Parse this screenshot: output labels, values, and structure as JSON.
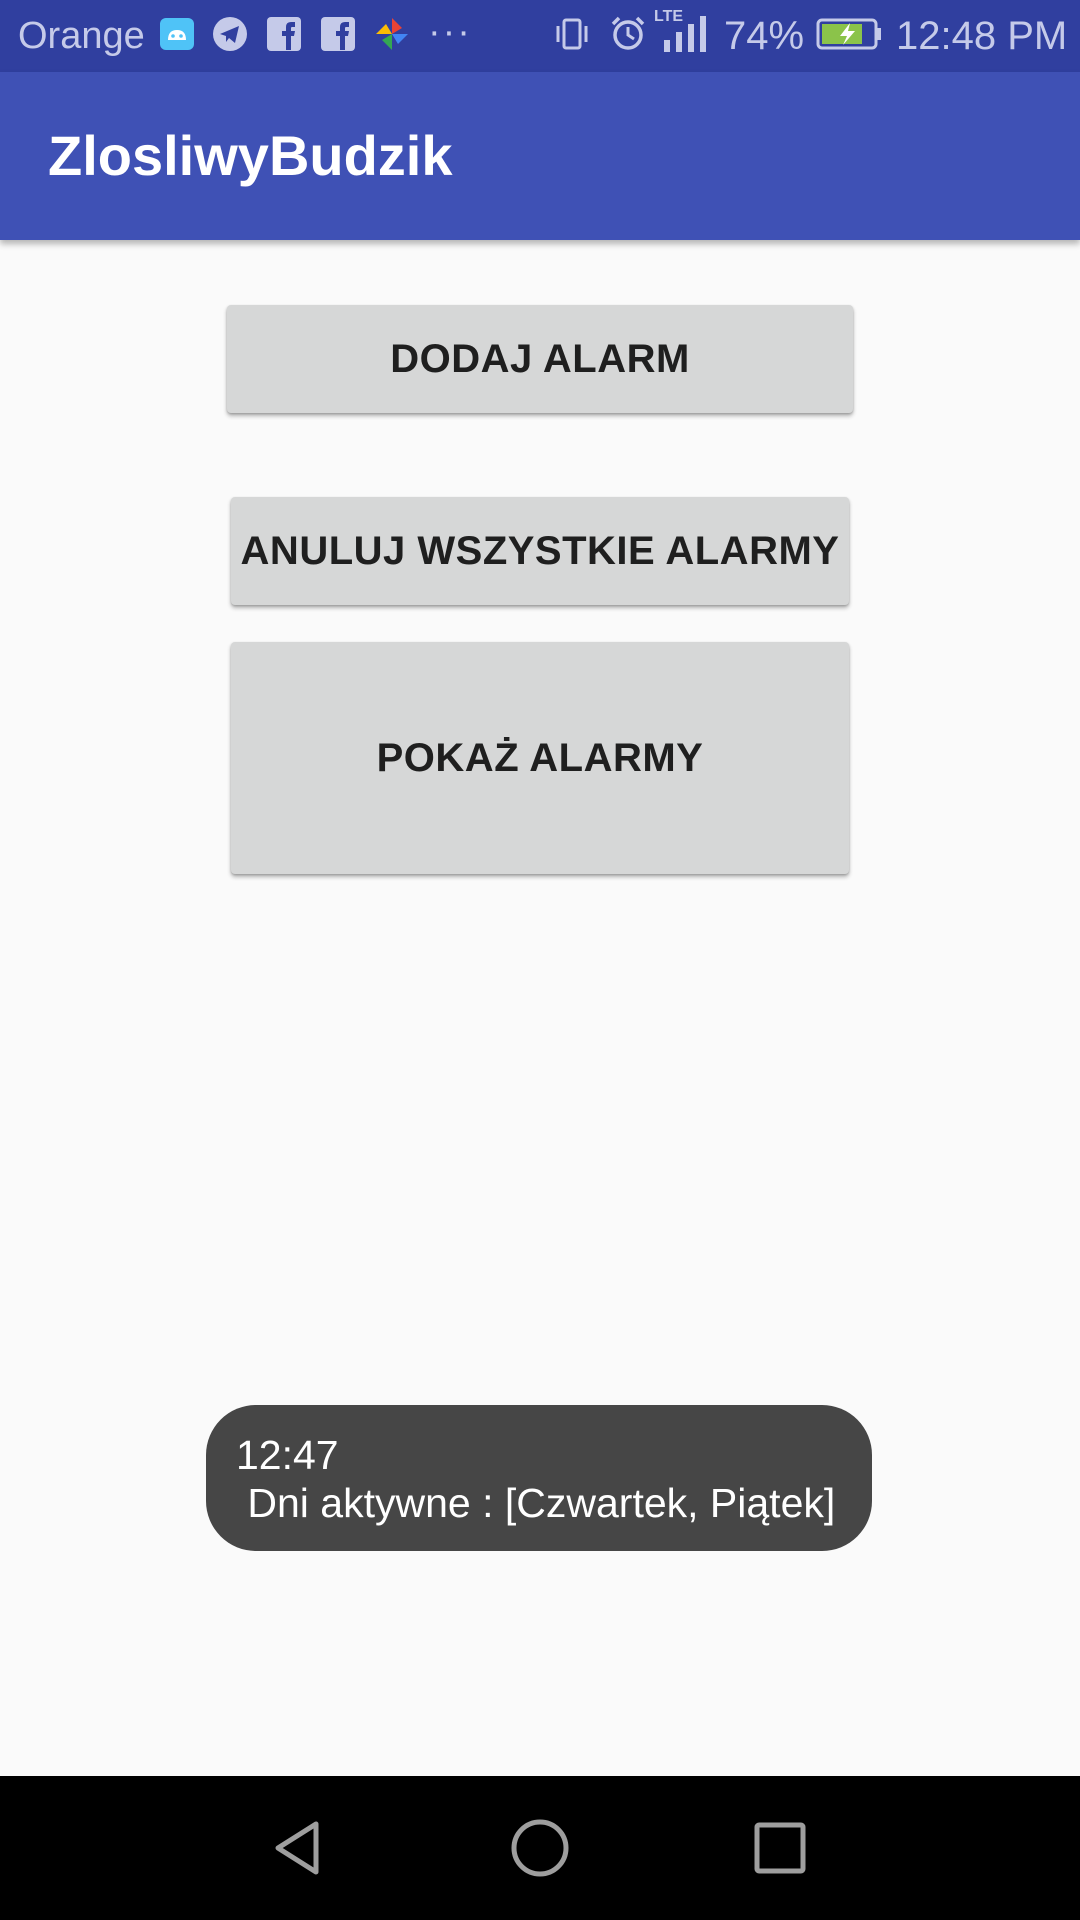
{
  "status_bar": {
    "carrier": "Orange",
    "more_indicator": "···",
    "battery_percent": "74%",
    "time": "12:48 PM",
    "network_label": "LTE",
    "icons": [
      "android-icon",
      "telegram-icon",
      "facebook-icon",
      "facebook-icon",
      "pinwheel-icon",
      "vibrate-icon",
      "alarm-icon",
      "signal-icon",
      "battery-charging-icon"
    ]
  },
  "app_bar": {
    "title": "ZlosliwyBudzik"
  },
  "buttons": {
    "add_alarm": "DODAJ ALARM",
    "cancel_all": "ANULUJ WSZYSTKIE ALARMY",
    "show_alarms": "POKAŻ ALARMY"
  },
  "toast": {
    "line1": "12:47",
    "line2": " Dni aktywne : [Czwartek, Piątek]"
  },
  "navigation": {
    "back": "back-icon",
    "home": "home-icon",
    "recents": "recents-icon"
  },
  "colors": {
    "status_bar": "#303f9f",
    "app_bar": "#3f51b5",
    "background": "#fafafa",
    "button": "#d6d7d7",
    "toast": "#464646",
    "nav_bar": "#000000"
  }
}
